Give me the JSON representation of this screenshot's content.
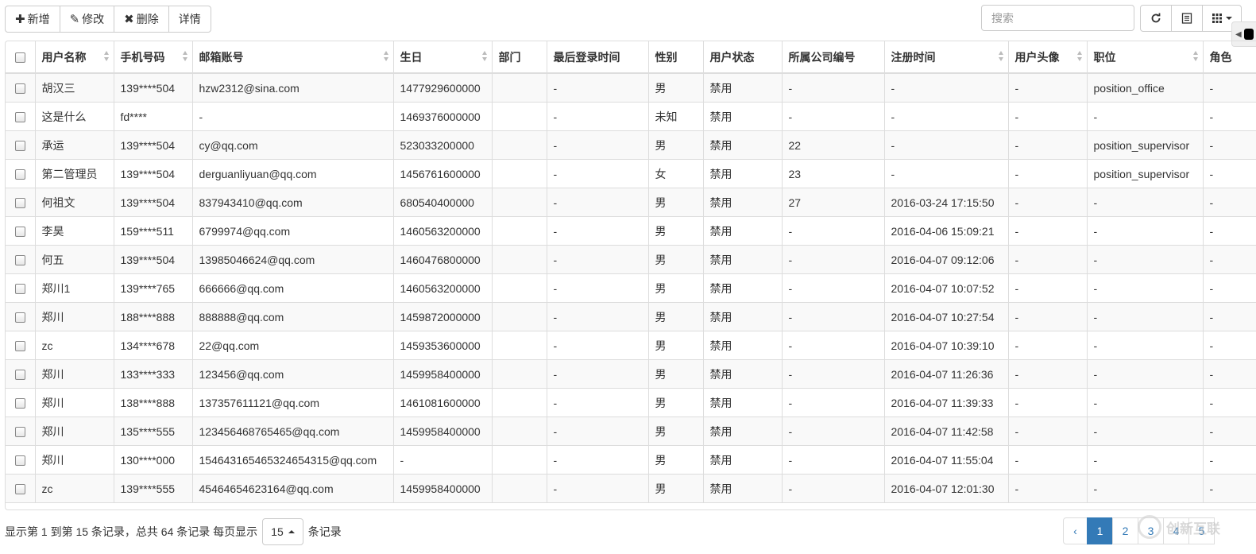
{
  "toolbar": {
    "add_label": "新增",
    "edit_label": "修改",
    "delete_label": "删除",
    "detail_label": "详情"
  },
  "search": {
    "placeholder": "搜索"
  },
  "icons": {
    "add": "plus-icon",
    "edit": "pencil-icon",
    "delete": "x-icon",
    "refresh": "refresh-icon",
    "toggle": "list-icon",
    "columns": "grid-icon"
  },
  "table": {
    "columns": [
      "用户名称",
      "手机号码",
      "邮箱账号",
      "生日",
      "部门",
      "最后登录时间",
      "性别",
      "用户状态",
      "所属公司编号",
      "注册时间",
      "用户头像",
      "职位",
      "角色"
    ],
    "rows": [
      [
        "胡汉三",
        "139****504",
        "hzw2312@sina.com",
        "1477929600000",
        "",
        "-",
        "男",
        "禁用",
        "-",
        "-",
        "-",
        "position_office",
        "-"
      ],
      [
        "这是什么",
        "fd****",
        "-",
        "1469376000000",
        "",
        "-",
        "未知",
        "禁用",
        "-",
        "-",
        "-",
        "-",
        "-"
      ],
      [
        "承运",
        "139****504",
        "cy@qq.com",
        "523033200000",
        "",
        "-",
        "男",
        "禁用",
        "22",
        "-",
        "-",
        "position_supervisor",
        "-"
      ],
      [
        "第二管理员",
        "139****504",
        "derguanliyuan@qq.com",
        "1456761600000",
        "",
        "-",
        "女",
        "禁用",
        "23",
        "-",
        "-",
        "position_supervisor",
        "-"
      ],
      [
        "何祖文",
        "139****504",
        "837943410@qq.com",
        "680540400000",
        "",
        "-",
        "男",
        "禁用",
        "27",
        "2016-03-24 17:15:50",
        "-",
        "-",
        "-"
      ],
      [
        "李昊",
        "159****511",
        "6799974@qq.com",
        "1460563200000",
        "",
        "-",
        "男",
        "禁用",
        "-",
        "2016-04-06 15:09:21",
        "-",
        "-",
        "-"
      ],
      [
        "何五",
        "139****504",
        "13985046624@qq.com",
        "1460476800000",
        "",
        "-",
        "男",
        "禁用",
        "-",
        "2016-04-07 09:12:06",
        "-",
        "-",
        "-"
      ],
      [
        "郑川1",
        "139****765",
        "666666@qq.com",
        "1460563200000",
        "",
        "-",
        "男",
        "禁用",
        "-",
        "2016-04-07 10:07:52",
        "-",
        "-",
        "-"
      ],
      [
        "郑川",
        "188****888",
        "888888@qq.com",
        "1459872000000",
        "",
        "-",
        "男",
        "禁用",
        "-",
        "2016-04-07 10:27:54",
        "-",
        "-",
        "-"
      ],
      [
        "zc",
        "134****678",
        "22@qq.com",
        "1459353600000",
        "",
        "-",
        "男",
        "禁用",
        "-",
        "2016-04-07 10:39:10",
        "-",
        "-",
        "-"
      ],
      [
        "郑川",
        "133****333",
        "123456@qq.com",
        "1459958400000",
        "",
        "-",
        "男",
        "禁用",
        "-",
        "2016-04-07 11:26:36",
        "-",
        "-",
        "-"
      ],
      [
        "郑川",
        "138****888",
        "137357611121@qq.com",
        "1461081600000",
        "",
        "-",
        "男",
        "禁用",
        "-",
        "2016-04-07 11:39:33",
        "-",
        "-",
        "-"
      ],
      [
        "郑川",
        "135****555",
        "123456468765465@qq.com",
        "1459958400000",
        "",
        "-",
        "男",
        "禁用",
        "-",
        "2016-04-07 11:42:58",
        "-",
        "-",
        "-"
      ],
      [
        "郑川",
        "130****000",
        "154643165465324654315@qq.com",
        "-",
        "",
        "-",
        "男",
        "禁用",
        "-",
        "2016-04-07 11:55:04",
        "-",
        "-",
        "-"
      ],
      [
        "zc",
        "139****555",
        "45464654623164@qq.com",
        "1459958400000",
        "",
        "-",
        "男",
        "禁用",
        "-",
        "2016-04-07 12:01:30",
        "-",
        "-",
        "-"
      ]
    ]
  },
  "footer": {
    "info_text": "显示第 1 到第 15 条记录，总共 64 条记录 每页显示",
    "page_size": "15",
    "suffix": "条记录"
  },
  "pagination": {
    "prev": "‹",
    "pages": [
      "1",
      "2",
      "3",
      "4",
      "5"
    ],
    "active": "1"
  },
  "watermark": {
    "text": "创新互联"
  }
}
